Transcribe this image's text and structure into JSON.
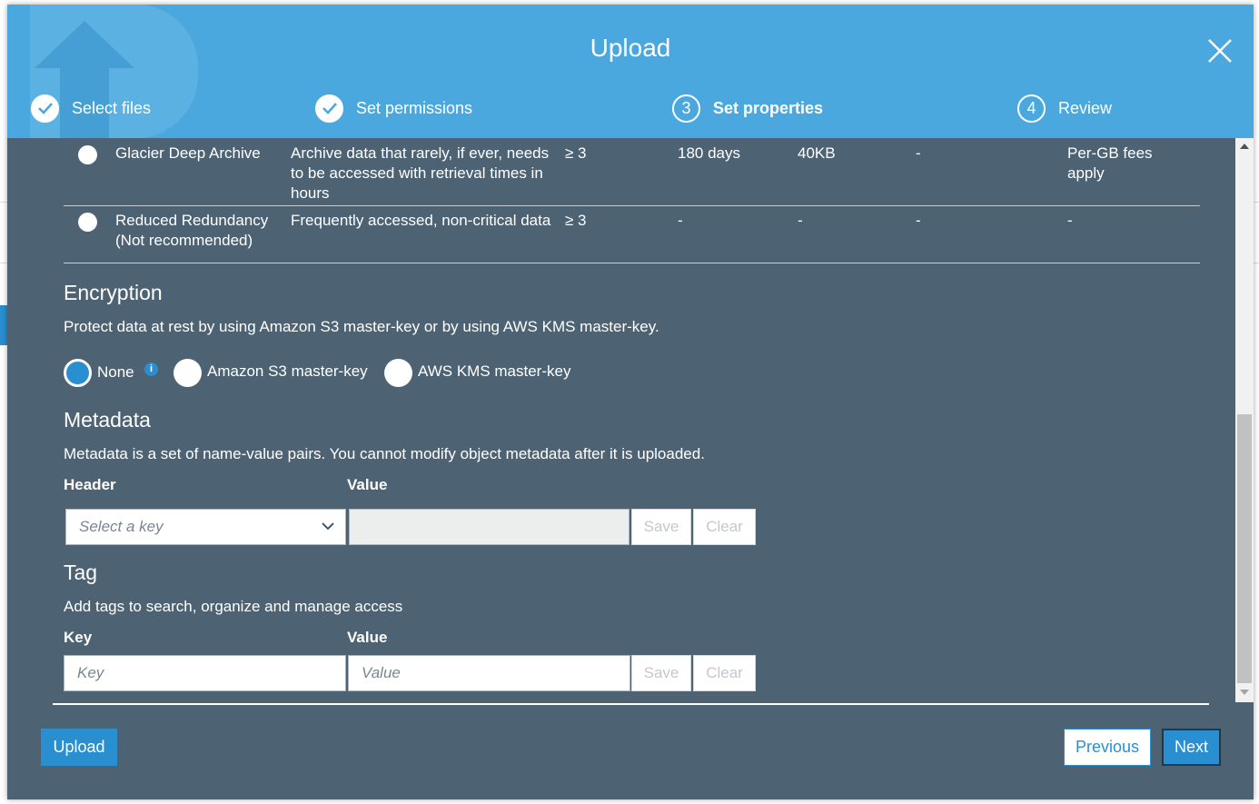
{
  "modal": {
    "title": "Upload"
  },
  "steps": [
    {
      "label": "Select files",
      "state": "done",
      "number": ""
    },
    {
      "label": "Set permissions",
      "state": "done",
      "number": ""
    },
    {
      "label": "Set properties",
      "state": "current",
      "number": "3"
    },
    {
      "label": "Review",
      "state": "todo",
      "number": "4"
    }
  ],
  "storage_classes": [
    {
      "name": "Glacier Deep Archive",
      "description": "Archive data that rarely, if ever, needs to be accessed with retrieval times in hours",
      "az": "≥ 3",
      "min_duration": "180 days",
      "min_size": "40KB",
      "monitoring": "-",
      "retrieval": "Per-GB fees apply"
    },
    {
      "name": "Reduced Redundancy (Not recommended)",
      "description": "Frequently accessed, non-critical data",
      "az": "≥ 3",
      "min_duration": "-",
      "min_size": "-",
      "monitoring": "-",
      "retrieval": "-"
    }
  ],
  "encryption": {
    "title": "Encryption",
    "description": "Protect data at rest by using Amazon S3 master-key or by using AWS KMS master-key.",
    "options": [
      {
        "label": "None",
        "selected": true
      },
      {
        "label": "Amazon S3 master-key",
        "selected": false
      },
      {
        "label": "AWS KMS master-key",
        "selected": false
      }
    ],
    "info_icon": "i"
  },
  "metadata": {
    "title": "Metadata",
    "description": "Metadata is a set of name-value pairs. You cannot modify object metadata after it is uploaded.",
    "header_label": "Header",
    "value_label": "Value",
    "select_placeholder": "Select a key",
    "save_label": "Save",
    "clear_label": "Clear"
  },
  "tag": {
    "title": "Tag",
    "description": "Add tags to search, organize and manage access",
    "key_label": "Key",
    "value_label": "Value",
    "key_placeholder": "Key",
    "value_placeholder": "Value",
    "save_label": "Save",
    "clear_label": "Clear"
  },
  "footer": {
    "upload_label": "Upload",
    "previous_label": "Previous",
    "next_label": "Next"
  },
  "colors": {
    "header": "#4aa8de",
    "body": "#4d6272",
    "accent": "#2a8fd0"
  }
}
